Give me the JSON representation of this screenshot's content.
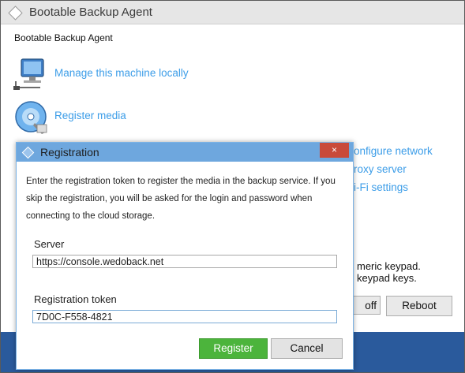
{
  "main_window": {
    "title": "Bootable Backup Agent",
    "heading": "Bootable Backup Agent",
    "actions": [
      {
        "label": "Manage this machine locally",
        "icon": "computer-network-icon"
      },
      {
        "label": "Register media",
        "icon": "disc-register-icon"
      }
    ],
    "side_links": [
      "onfigure network",
      "roxy server",
      "i-Fi settings"
    ],
    "keypad_lines": [
      "meric keypad.",
      "keypad keys."
    ],
    "buttons": {
      "off_partial": "off",
      "reboot": "Reboot"
    }
  },
  "dialog": {
    "title": "Registration",
    "close_glyph": "×",
    "description": "Enter the registration token to register the media in the backup service. If you skip the registration, you will be asked for the login and password when connecting to the cloud storage.",
    "server_label": "Server",
    "server_value": "https://console.wedoback.net",
    "token_label": "Registration token",
    "token_value": "7D0C-F558-4821",
    "register_label": "Register",
    "cancel_label": "Cancel"
  },
  "colors": {
    "link": "#3c9de8",
    "dialog_titlebar": "#6ea7de",
    "register_button": "#4cb43c",
    "close_button": "#c94a3a",
    "taskbar": "#2a5a9c"
  }
}
